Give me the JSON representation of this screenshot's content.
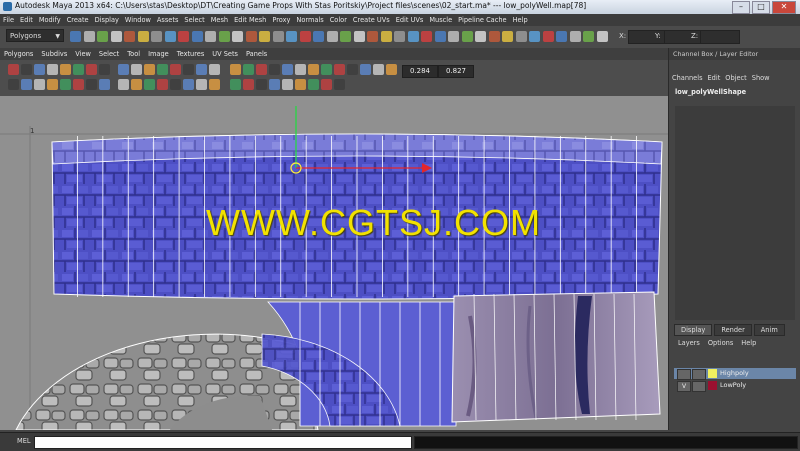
{
  "window": {
    "title": "Autodesk Maya 2013 x64: C:\\Users\\stas\\Desktop\\DT\\Creating Game Props With Stas Poritskiy\\Project files\\scenes\\02_start.ma*    ---    low_polyWell.map[78]"
  },
  "main_menu": [
    "File",
    "Edit",
    "Modify",
    "Create",
    "Display",
    "Window",
    "Assets",
    "Select",
    "Mesh",
    "Edit Mesh",
    "Proxy",
    "Normals",
    "Color",
    "Create UVs",
    "Edit UVs",
    "Muscle",
    "Pipeline Cache",
    "Help"
  ],
  "mode_dropdown": "Polygons",
  "xyz": {
    "x": "X:",
    "y": "Y:",
    "z": "Z:"
  },
  "uv_editor": {
    "menu": [
      "Polygons",
      "Subdivs",
      "View",
      "Select",
      "Tool",
      "Image",
      "Textures",
      "UV Sets",
      "Panels"
    ],
    "fields": [
      "0.284",
      "0.827"
    ],
    "grid_label": "1"
  },
  "watermark": "WWW.CGTSJ.COM",
  "channel_box": {
    "header": "Channel Box / Layer Editor",
    "menu": [
      "Channels",
      "Edit",
      "Object",
      "Show"
    ],
    "shape_name": "low_polyWellShape"
  },
  "layer_editor": {
    "tabs": [
      "Display",
      "Render",
      "Anim"
    ],
    "menu": [
      "Layers",
      "Options",
      "Help"
    ],
    "layers": [
      {
        "v": "",
        "name": "Highpoly",
        "color": "#f0f060"
      },
      {
        "v": "V",
        "name": "LowPoly",
        "color": "#9a1030"
      }
    ]
  },
  "command_line": {
    "label": "MEL"
  },
  "colors": {
    "uv_blue": "#5b5bd0",
    "texture_purple": "#8a7fa6",
    "watermark": "#f2e200"
  }
}
